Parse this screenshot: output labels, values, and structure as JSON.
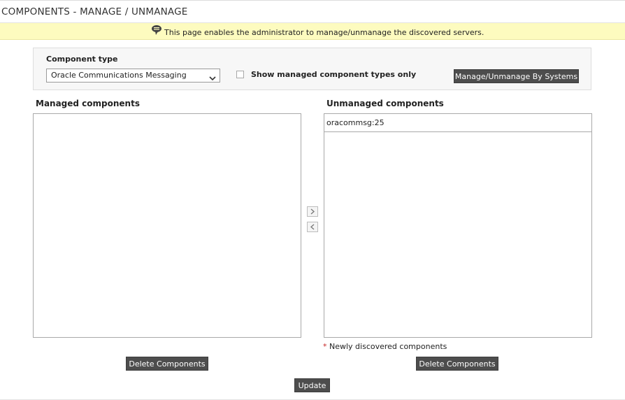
{
  "header": {
    "title": "COMPONENTS - MANAGE / UNMANAGE",
    "info_message": "This page enables the administrator to manage/unmanage the discovered servers.",
    "info_icon": "speech-bubble-icon"
  },
  "filter": {
    "component_type_label": "Component type",
    "component_type_value": "Oracle Communications Messaging",
    "show_managed_only_label": "Show managed component types only",
    "show_managed_only_checked": false,
    "manage_by_systems_label": "Manage/Unmanage By Systems"
  },
  "managed": {
    "heading": "Managed components",
    "items": [],
    "delete_label": "Delete Components"
  },
  "unmanaged": {
    "heading": "Unmanaged components",
    "items": [
      "oracommsg:25"
    ],
    "delete_label": "Delete Components"
  },
  "transfer": {
    "move_right_icon": "chevron-right-icon",
    "move_left_icon": "chevron-left-icon"
  },
  "note": {
    "marker": "*",
    "text": "Newly discovered components"
  },
  "actions": {
    "update_label": "Update"
  },
  "colors": {
    "info_bar_bg": "#fdfbbf",
    "button_bg": "#4d4d4d",
    "panel_bg": "#f7f7f7",
    "note_marker": "#c62828"
  }
}
